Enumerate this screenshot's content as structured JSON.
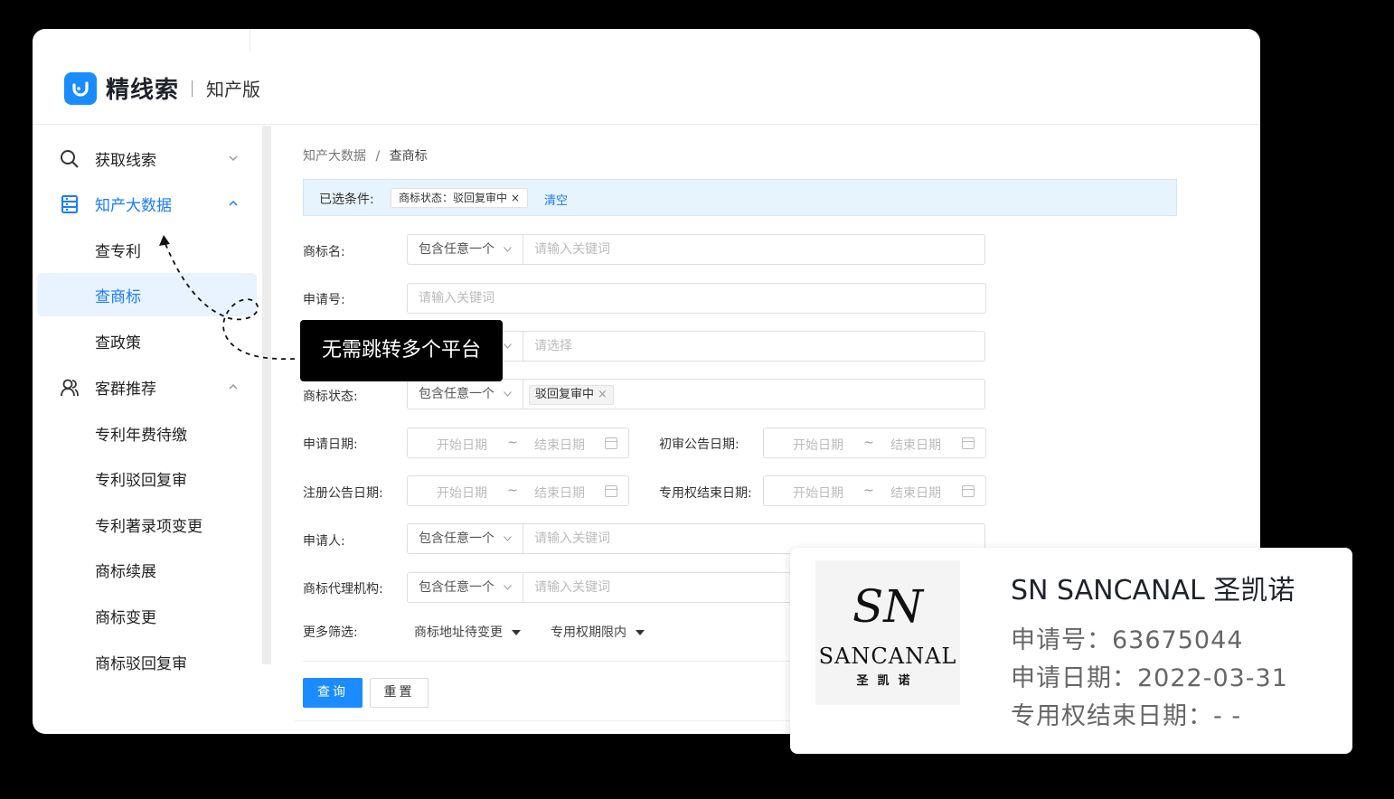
{
  "brand": {
    "name": "精线索",
    "edition": "知产版",
    "accent": "#1a8cff"
  },
  "sidebar": {
    "items": [
      {
        "label": "获取线索",
        "icon": "search-icon"
      },
      {
        "label": "知产大数据",
        "icon": "database-icon"
      },
      {
        "label": "查专利"
      },
      {
        "label": "查商标"
      },
      {
        "label": "查政策"
      },
      {
        "label": "客群推荐",
        "icon": "users-icon"
      },
      {
        "label": "专利年费待缴"
      },
      {
        "label": "专利驳回复审"
      },
      {
        "label": "专利著录项变更"
      },
      {
        "label": "商标续展"
      },
      {
        "label": "商标变更"
      },
      {
        "label": "商标驳回复审"
      }
    ]
  },
  "breadcrumb": {
    "parent": "知产大数据",
    "sep": "/",
    "current": "查商标"
  },
  "filter_bar": {
    "label": "已选条件:",
    "tag": "商标状态：驳回复审中 ×",
    "clear": "清空"
  },
  "form": {
    "mark_name": {
      "label": "商标名:",
      "mode": "包含任意一个",
      "placeholder": "请输入关键词"
    },
    "app_no": {
      "label": "申请号:",
      "placeholder": "请输入关键词"
    },
    "row3": {
      "placeholder": "请选择"
    },
    "status": {
      "label": "商标状态:",
      "mode": "包含任意一个",
      "chip": "驳回复审中",
      "chip_close": "×"
    },
    "app_date": {
      "label": "申请日期:",
      "start": "开始日期",
      "tilde": "~",
      "end": "结束日期"
    },
    "first_pub": {
      "label": "初审公告日期:",
      "start": "开始日期",
      "tilde": "~",
      "end": "结束日期"
    },
    "reg_pub": {
      "label": "注册公告日期:",
      "start": "开始日期",
      "tilde": "~",
      "end": "结束日期"
    },
    "right_end": {
      "label": "专用权结束日期:",
      "start": "开始日期",
      "tilde": "~",
      "end": "结束日期"
    },
    "applicant": {
      "label": "申请人:",
      "mode": "包含任意一个",
      "placeholder": "请输入关键词"
    },
    "agency": {
      "label": "商标代理机构:",
      "mode": "包含任意一个",
      "placeholder": "请输入关键词"
    },
    "more": {
      "label": "更多筛选:",
      "opt1": "商标地址待变更",
      "opt2": "专用权期限内"
    }
  },
  "buttons": {
    "query": "查询",
    "reset": "重置"
  },
  "tooltip": "无需跳转多个平台",
  "card": {
    "mono": "SN",
    "brand_en": "SANCANAL",
    "brand_cn": "圣凯诺",
    "title": "SN SANCANAL 圣凯诺",
    "app_no": "申请号：63675044",
    "app_date": "申请日期：2022-03-31",
    "right_end": "专用权结束日期：- -"
  }
}
